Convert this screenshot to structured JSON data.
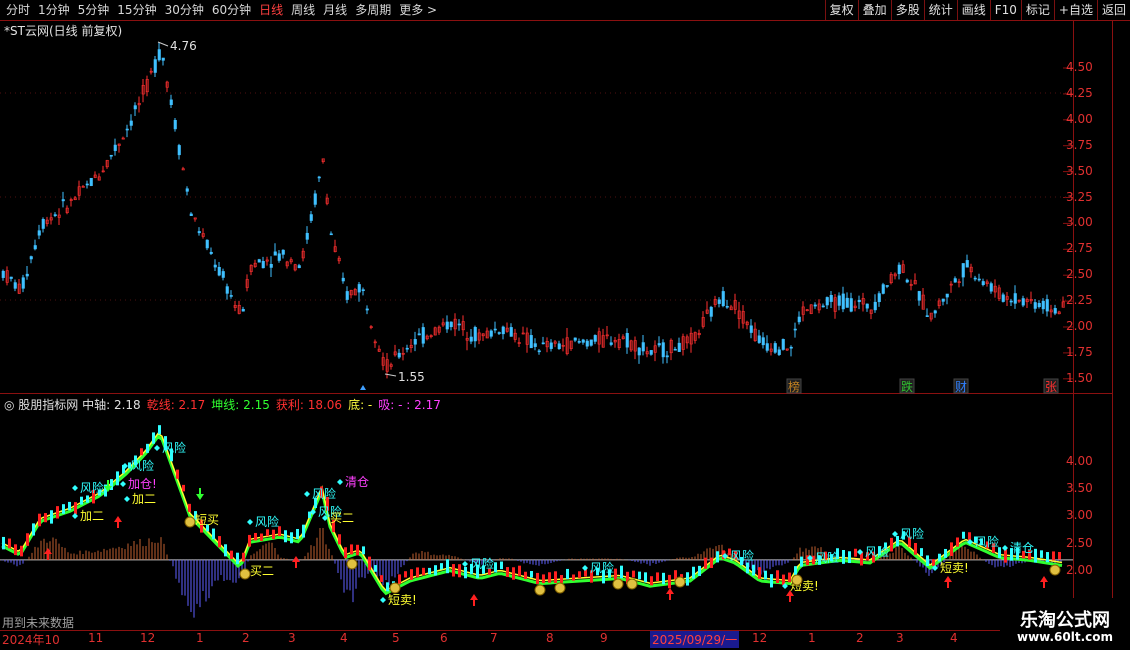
{
  "toolbar": {
    "periods": [
      "分时",
      "1分钟",
      "5分钟",
      "15分钟",
      "30分钟",
      "60分钟",
      "日线",
      "周线",
      "月线",
      "多周期",
      "更多 >"
    ],
    "active_period": "日线",
    "buttons": [
      "复权",
      "叠加",
      "多股",
      "统计",
      "画线",
      "F10",
      "标记",
      "+自选",
      "返回"
    ]
  },
  "main_panel": {
    "title": "*ST云网(日线 前复权)",
    "high_label": "4.76",
    "low_label": "1.55",
    "y_ticks": [
      "4.50",
      "4.25",
      "4.00",
      "3.75",
      "3.50",
      "3.25",
      "3.00",
      "2.75",
      "2.50",
      "2.25",
      "2.00",
      "1.75",
      "1.50"
    ],
    "tags": [
      "榜",
      "跌",
      "财",
      "张"
    ]
  },
  "indicator_panel": {
    "name": "股朋指标网",
    "fields": [
      {
        "label": "中轴:",
        "value": "2.18",
        "color": "#e0e0e0"
      },
      {
        "label": "乾线:",
        "value": "2.17",
        "color": "#ff3030"
      },
      {
        "label": "坤线:",
        "value": "2.15",
        "color": "#30ff30"
      },
      {
        "label": "获利:",
        "value": "18.06",
        "color": "#ff3030"
      },
      {
        "label": "底:",
        "value": "-",
        "color": "#ffff40"
      },
      {
        "label": "吸:",
        "value": "- : 2.17",
        "color": "#ff40ff"
      }
    ],
    "y_ticks": [
      "4.00",
      "3.50",
      "3.00",
      "2.50",
      "2.00"
    ],
    "footer_text": "用到未来数据",
    "signals": [
      "风险",
      "加仓!",
      "加二",
      "短买",
      "减仓",
      "买二",
      "短卖!",
      "清仓",
      "跳空"
    ]
  },
  "x_axis": {
    "labels": [
      "2024年10",
      "11",
      "12",
      "1",
      "2",
      "3",
      "4",
      "5",
      "6",
      "7",
      "8",
      "9",
      "2025/09/29/一",
      "12",
      "1",
      "2",
      "3",
      "4"
    ]
  },
  "watermark": {
    "line1": "乐淘公式网",
    "line2": "www.60lt.com"
  },
  "colors": {
    "up": "#ff3030",
    "down": "#40c0ff",
    "frame": "#8a1010",
    "axis_text": "#e03030"
  }
}
